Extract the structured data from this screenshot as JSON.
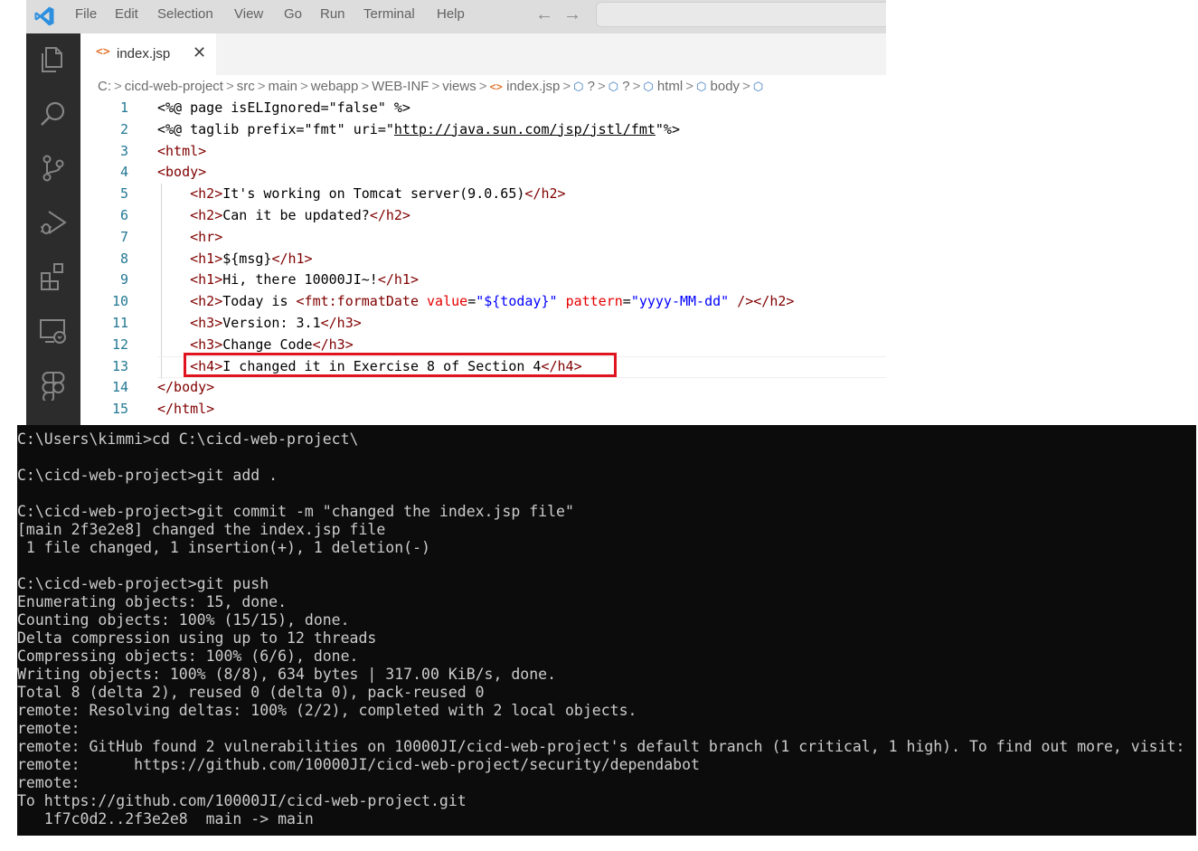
{
  "menu": [
    "File",
    "Edit",
    "Selection",
    "View",
    "Go",
    "Run",
    "Terminal",
    "Help"
  ],
  "nav": {
    "back": "←",
    "forward": "→"
  },
  "activity_icons": [
    "explorer-icon",
    "search-icon",
    "source-control-icon",
    "run-debug-icon",
    "extensions-icon",
    "remote-explorer-icon",
    "figma-icon"
  ],
  "tab": {
    "icon": "<>",
    "label": "index.jsp",
    "close": "✕"
  },
  "breadcrumb": {
    "segments": [
      "C:",
      "cicd-web-project",
      "src",
      "main",
      "webapp",
      "WEB-INF",
      "views"
    ],
    "file": "index.jsp",
    "symbols": [
      "?",
      "?",
      "html",
      "body"
    ],
    "separator": ">"
  },
  "editor": {
    "current_line": 13,
    "lines": [
      [
        {
          "t": "<%@ page isELIgnored=\"false\" %>",
          "c": ""
        }
      ],
      [
        {
          "t": "<%@ taglib prefix=\"fmt\" uri=\"",
          "c": ""
        },
        {
          "t": "http://java.sun.com/jsp/jstl/fmt",
          "c": "u"
        },
        {
          "t": "\"%>",
          "c": ""
        }
      ],
      [
        {
          "t": "<html>",
          "c": "tg"
        }
      ],
      [
        {
          "t": "<body>",
          "c": "tg"
        }
      ],
      [
        {
          "t": "    ",
          "c": ""
        },
        {
          "t": "<h2>",
          "c": "tg"
        },
        {
          "t": "It's working on Tomcat server(9.0.65)",
          "c": ""
        },
        {
          "t": "</h2>",
          "c": "tg"
        }
      ],
      [
        {
          "t": "    ",
          "c": ""
        },
        {
          "t": "<h2>",
          "c": "tg"
        },
        {
          "t": "Can it be updated?",
          "c": ""
        },
        {
          "t": "</h2>",
          "c": "tg"
        }
      ],
      [
        {
          "t": "    ",
          "c": ""
        },
        {
          "t": "<hr>",
          "c": "tg"
        }
      ],
      [
        {
          "t": "    ",
          "c": ""
        },
        {
          "t": "<h1>",
          "c": "tg"
        },
        {
          "t": "${msg}",
          "c": ""
        },
        {
          "t": "</h1>",
          "c": "tg"
        }
      ],
      [
        {
          "t": "    ",
          "c": ""
        },
        {
          "t": "<h1>",
          "c": "tg"
        },
        {
          "t": "Hi, there 10000JI~!",
          "c": ""
        },
        {
          "t": "</h1>",
          "c": "tg"
        }
      ],
      [
        {
          "t": "    ",
          "c": ""
        },
        {
          "t": "<h2>",
          "c": "tg"
        },
        {
          "t": "Today is ",
          "c": ""
        },
        {
          "t": "<fmt:formatDate ",
          "c": "tg"
        },
        {
          "t": "value",
          "c": "at"
        },
        {
          "t": "=",
          "c": ""
        },
        {
          "t": "\"${today}\"",
          "c": "st"
        },
        {
          "t": " ",
          "c": ""
        },
        {
          "t": "pattern",
          "c": "at"
        },
        {
          "t": "=",
          "c": ""
        },
        {
          "t": "\"yyyy-MM-dd\"",
          "c": "st"
        },
        {
          "t": " />",
          "c": "tg"
        },
        {
          "t": "</h2>",
          "c": "tg"
        }
      ],
      [
        {
          "t": "    ",
          "c": ""
        },
        {
          "t": "<h3>",
          "c": "tg"
        },
        {
          "t": "Version: 3.1",
          "c": ""
        },
        {
          "t": "</h3>",
          "c": "tg"
        }
      ],
      [
        {
          "t": "    ",
          "c": ""
        },
        {
          "t": "<h3>",
          "c": "tg"
        },
        {
          "t": "Change Code",
          "c": ""
        },
        {
          "t": "</h3>",
          "c": "tg"
        }
      ],
      [
        {
          "t": "    ",
          "c": ""
        },
        {
          "t": "<h4>",
          "c": "tg"
        },
        {
          "t": "I changed it in Exercise 8 of Section 4",
          "c": ""
        },
        {
          "t": "</h4>",
          "c": "tg"
        }
      ],
      [
        {
          "t": "</body>",
          "c": "tg"
        }
      ],
      [
        {
          "t": "</html>",
          "c": "tg"
        }
      ]
    ]
  },
  "terminal": {
    "lines": [
      "C:\\Users\\kimmi>cd C:\\cicd-web-project\\",
      "",
      "C:\\cicd-web-project>git add .",
      "",
      "C:\\cicd-web-project>git commit -m \"changed the index.jsp file\"",
      "[main 2f3e2e8] changed the index.jsp file",
      " 1 file changed, 1 insertion(+), 1 deletion(-)",
      "",
      "C:\\cicd-web-project>git push",
      "Enumerating objects: 15, done.",
      "Counting objects: 100% (15/15), done.",
      "Delta compression using up to 12 threads",
      "Compressing objects: 100% (6/6), done.",
      "Writing objects: 100% (8/8), 634 bytes | 317.00 KiB/s, done.",
      "Total 8 (delta 2), reused 0 (delta 0), pack-reused 0",
      "remote: Resolving deltas: 100% (2/2), completed with 2 local objects.",
      "remote:",
      "remote: GitHub found 2 vulnerabilities on 10000JI/cicd-web-project's default branch (1 critical, 1 high). To find out more, visit:",
      "remote:      https://github.com/10000JI/cicd-web-project/security/dependabot",
      "remote:",
      "To https://github.com/10000JI/cicd-web-project.git",
      "   1f7c0d2..2f3e2e8  main -> main"
    ]
  },
  "colors": {
    "highlight_box": "#e0141e",
    "activity_bar": "#2c2c2c",
    "terminal_bg": "#0c0c0c"
  }
}
